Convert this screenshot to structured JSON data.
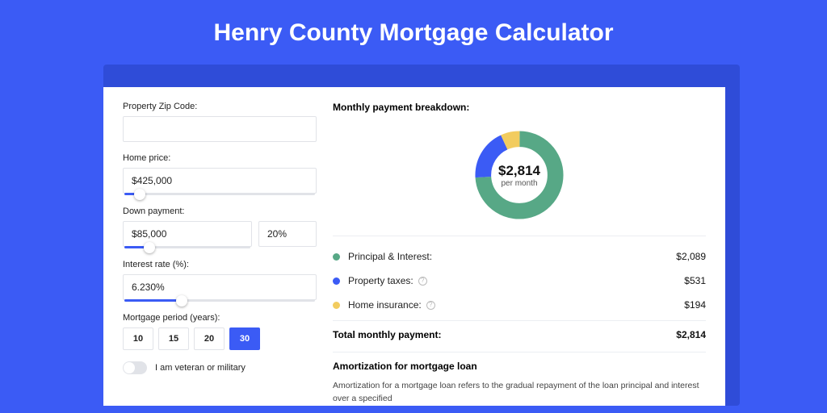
{
  "title": "Henry County Mortgage Calculator",
  "form": {
    "zip_label": "Property Zip Code:",
    "zip_value": "",
    "home_price_label": "Home price:",
    "home_price_value": "$425,000",
    "home_price_slider_pct": 8,
    "down_payment_label": "Down payment:",
    "down_payment_value": "$85,000",
    "down_payment_pct_value": "20%",
    "down_payment_slider_pct": 20,
    "interest_label": "Interest rate (%):",
    "interest_value": "6.230%",
    "interest_slider_pct": 30,
    "period_label": "Mortgage period (years):",
    "period_options": [
      "10",
      "15",
      "20",
      "30"
    ],
    "period_active": "30",
    "veteran_label": "I am veteran or military"
  },
  "breakdown": {
    "title": "Monthly payment breakdown:",
    "amount": "$2,814",
    "sub": "per month",
    "rows": [
      {
        "label": "Principal & Interest:",
        "value": "$2,089",
        "color": "#57a886",
        "info": false,
        "pct": 74
      },
      {
        "label": "Property taxes:",
        "value": "$531",
        "color": "#3b5bf5",
        "info": true,
        "pct": 19
      },
      {
        "label": "Home insurance:",
        "value": "$194",
        "color": "#f2cc5f",
        "info": true,
        "pct": 7
      }
    ],
    "total_label": "Total monthly payment:",
    "total_value": "$2,814"
  },
  "amort": {
    "title": "Amortization for mortgage loan",
    "text": "Amortization for a mortgage loan refers to the gradual repayment of the loan principal and interest over a specified"
  },
  "chart_data": {
    "type": "pie",
    "title": "Monthly payment breakdown",
    "categories": [
      "Principal & Interest",
      "Property taxes",
      "Home insurance"
    ],
    "values": [
      2089,
      531,
      194
    ],
    "colors": [
      "#57a886",
      "#3b5bf5",
      "#f2cc5f"
    ],
    "total": 2814,
    "center_label": "$2,814",
    "center_sub": "per month"
  }
}
